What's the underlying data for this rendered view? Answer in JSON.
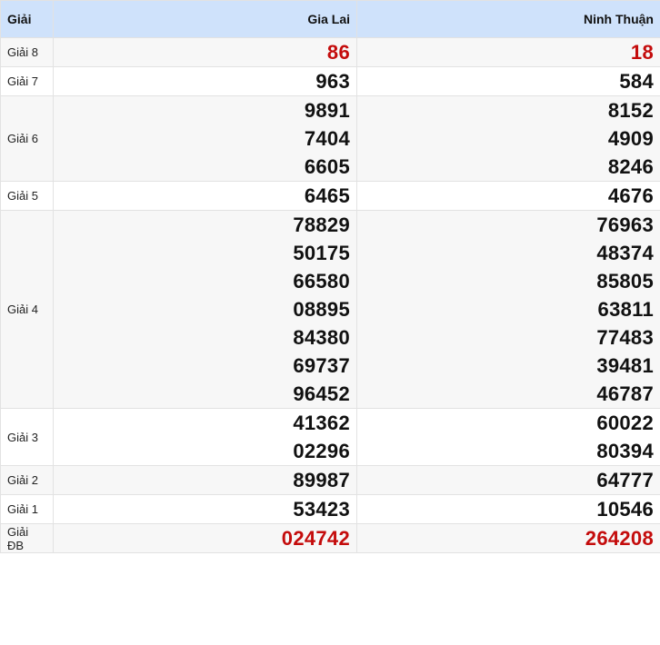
{
  "header": {
    "prize_label": "Giải",
    "provinces": [
      "Gia Lai",
      "Ninh Thuận"
    ]
  },
  "colors": {
    "header_bg": "#cfe2fb",
    "highlight": "#c40c0c",
    "normal": "#111111"
  },
  "rows": [
    {
      "prize": "Giải 8",
      "highlight": true,
      "results": [
        [
          "86"
        ],
        [
          "18"
        ]
      ]
    },
    {
      "prize": "Giải 7",
      "highlight": false,
      "results": [
        [
          "963"
        ],
        [
          "584"
        ]
      ]
    },
    {
      "prize": "Giải 6",
      "highlight": false,
      "results": [
        [
          "9891",
          "7404",
          "6605"
        ],
        [
          "8152",
          "4909",
          "8246"
        ]
      ]
    },
    {
      "prize": "Giải 5",
      "highlight": false,
      "results": [
        [
          "6465"
        ],
        [
          "4676"
        ]
      ]
    },
    {
      "prize": "Giải 4",
      "highlight": false,
      "results": [
        [
          "78829",
          "50175",
          "66580",
          "08895",
          "84380",
          "69737",
          "96452"
        ],
        [
          "76963",
          "48374",
          "85805",
          "63811",
          "77483",
          "39481",
          "46787"
        ]
      ]
    },
    {
      "prize": "Giải 3",
      "highlight": false,
      "results": [
        [
          "41362",
          "02296"
        ],
        [
          "60022",
          "80394"
        ]
      ]
    },
    {
      "prize": "Giải 2",
      "highlight": false,
      "results": [
        [
          "89987"
        ],
        [
          "64777"
        ]
      ]
    },
    {
      "prize": "Giải 1",
      "highlight": false,
      "results": [
        [
          "53423"
        ],
        [
          "10546"
        ]
      ]
    },
    {
      "prize": "Giải ĐB",
      "highlight": true,
      "results": [
        [
          "024742"
        ],
        [
          "264208"
        ]
      ]
    }
  ]
}
